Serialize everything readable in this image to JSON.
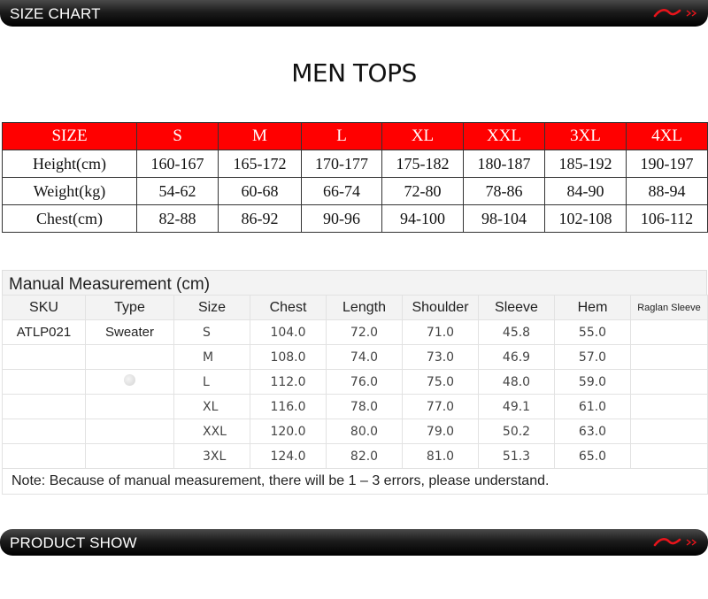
{
  "top_banner": {
    "title": "SIZE CHART",
    "logo_icon": "brand-swoosh-icon"
  },
  "heading": "MEN TOPS",
  "size_chart": {
    "header_color": "#ff0000",
    "headers": [
      "SIZE",
      "S",
      "M",
      "L",
      "XL",
      "XXL",
      "3XL",
      "4XL"
    ],
    "rows": [
      {
        "label": "Height(cm)",
        "values": [
          "160-167",
          "165-172",
          "170-177",
          "175-182",
          "180-187",
          "185-192",
          "190-197"
        ]
      },
      {
        "label": "Weight(kg)",
        "values": [
          "54-62",
          "60-68",
          "66-74",
          "72-80",
          "78-86",
          "84-90",
          "88-94"
        ]
      },
      {
        "label": "Chest(cm)",
        "values": [
          "82-88",
          "86-92",
          "90-96",
          "94-100",
          "98-104",
          "102-108",
          "106-112"
        ]
      }
    ]
  },
  "manual": {
    "title": "Manual Measurement (cm)",
    "headers": [
      "SKU",
      "Type",
      "Size",
      "Chest",
      "Length",
      "Shoulder",
      "Sleeve",
      "Hem",
      "Raglan Sleeve"
    ],
    "rows": [
      [
        "ATLP021",
        "Sweater",
        "S",
        "104.0",
        "72.0",
        "71.0",
        "45.8",
        "55.0",
        ""
      ],
      [
        "",
        "",
        "M",
        "108.0",
        "74.0",
        "73.0",
        "46.9",
        "57.0",
        ""
      ],
      [
        "",
        "",
        "L",
        "112.0",
        "76.0",
        "75.0",
        "48.0",
        "59.0",
        ""
      ],
      [
        "",
        "",
        "XL",
        "116.0",
        "78.0",
        "77.0",
        "49.1",
        "61.0",
        ""
      ],
      [
        "",
        "",
        "XXL",
        "120.0",
        "80.0",
        "79.0",
        "50.2",
        "63.0",
        ""
      ],
      [
        "",
        "",
        "3XL",
        "124.0",
        "82.0",
        "81.0",
        "51.3",
        "65.0",
        ""
      ]
    ],
    "note": "Note: Because of manual measurement, there will be 1 – 3 errors, please understand."
  },
  "bottom_banner": {
    "title": "PRODUCT SHOW",
    "logo_icon": "brand-swoosh-icon"
  }
}
